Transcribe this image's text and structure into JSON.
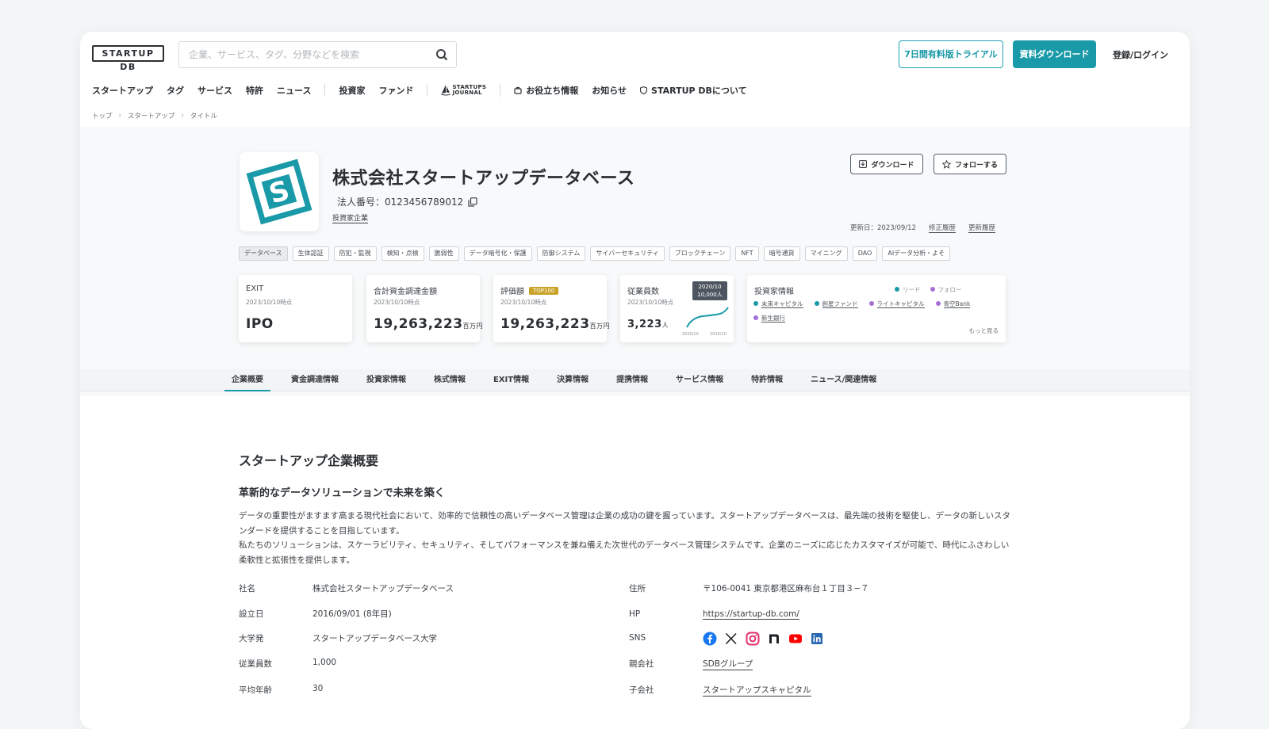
{
  "header": {
    "logo_text": "STARTUP DB",
    "search_placeholder": "企業、サービス、タグ、分野などを検索",
    "trial_button": "7日間有料版トライアル",
    "download_button": "資料ダウンロード",
    "login": "登録/ログイン"
  },
  "nav": {
    "items": [
      "スタートアップ",
      "タグ",
      "サービス",
      "特許",
      "ニュース"
    ],
    "investor_items": [
      "投資家",
      "ファンド"
    ],
    "journal": [
      "STARTUPS",
      "JOURNAL"
    ],
    "info": "お役立ち情報",
    "notice": "お知らせ",
    "about": "STARTUP DBについて"
  },
  "breadcrumb": [
    "トップ",
    "スタートアップ",
    "タイトル"
  ],
  "company": {
    "name": "株式会社スタートアップデータベース",
    "corp_number": "法人番号：0123456789012",
    "investor_tag": "投資家企業",
    "download": "ダウンロード",
    "follow": "フォローする",
    "updated": "更新日：2023/09/12",
    "edit_history": "修正履歴",
    "update_history": "更新履歴",
    "logo_letter": "S",
    "brand_color": "#1a9aa8"
  },
  "tags": [
    "データベース",
    "生体認証",
    "防犯・監視",
    "検知・点検",
    "脆弱性",
    "データ暗号化・保護",
    "防御システム",
    "サイバーセキュリティ",
    "ブロックチェーン",
    "NFT",
    "暗号通貨",
    "マイニング",
    "DAO",
    "AIデータ分析・よそ"
  ],
  "cards": {
    "exit": {
      "title": "EXIT",
      "date": "2023/10/10時点",
      "value": "IPO"
    },
    "funding": {
      "title": "合計資金調達金額",
      "date": "2023/10/10時点",
      "value": "19,263,223",
      "unit": "百万円"
    },
    "valuation": {
      "title": "評価額",
      "badge": "TOP100",
      "date": "2023/10/10時点",
      "value": "19,263,223",
      "unit": "百万円"
    },
    "employees": {
      "title": "従業員数",
      "date": "2023/10/10時点",
      "value": "3,223",
      "unit": "人",
      "tip_date": "2020/10",
      "tip_value": "10,000人",
      "axis_start": "2020/10",
      "axis_end": "2024/10"
    },
    "investors": {
      "title": "投資家情報",
      "legend_lead": "リード",
      "legend_follow": "フォロー",
      "lead_color": "#1a9aa8",
      "follow_color": "#a66fd8",
      "list": [
        {
          "name": "未来キャピタル",
          "type": "lead"
        },
        {
          "name": "創星ファンド",
          "type": "lead"
        },
        {
          "name": "ライトキャピタル",
          "type": "follow"
        },
        {
          "name": "青空Bank",
          "type": "follow"
        },
        {
          "name": "新生銀行",
          "type": "follow"
        }
      ],
      "more": "もっと見る"
    }
  },
  "tabs": [
    "企業概要",
    "資金調達情報",
    "投資家情報",
    "株式情報",
    "EXIT情報",
    "決算情報",
    "提携情報",
    "サービス情報",
    "特許情報",
    "ニュース/関連情報"
  ],
  "overview": {
    "title": "スタートアップ企業概要",
    "subtitle": "革新的なデータソリューションで未来を築く",
    "body1": "データの重要性がますます高まる現代社会において、効率的で信頼性の高いデータベース管理は企業の成功の鍵を握っています。スタートアップデータベースは、最先端の技術を駆使し、データの新しいスタンダードを提供することを目指しています。",
    "body2": "私たちのソリューションは、スケーラビリティ、セキュリティ、そしてパフォーマンスを兼ね備えた次世代のデータベース管理システムです。企業のニーズに応じたカスタマイズが可能で、時代にふさわしい柔軟性と拡張性を提供します。"
  },
  "details": {
    "left": [
      {
        "label": "社名",
        "value": "株式会社スタートアップデータベース"
      },
      {
        "label": "設立日",
        "value": "2016/09/01 (8年目)"
      },
      {
        "label": "大学発",
        "value": "スタートアップデータベース大学"
      },
      {
        "label": "従業員数",
        "value": "1,000"
      },
      {
        "label": "平均年齢",
        "value": "30"
      }
    ],
    "right": [
      {
        "label": "住所",
        "value": "〒106-0041 東京都港区麻布台１丁目３−７"
      },
      {
        "label": "HP",
        "value": "https://startup-db.com/"
      },
      {
        "label": "SNS",
        "value": ""
      },
      {
        "label": "親会社",
        "value": "SDBグループ"
      },
      {
        "label": "子会社",
        "value": "スタートアップスキャピタル"
      }
    ],
    "sns_icons": [
      "facebook-icon",
      "x-icon",
      "instagram-icon",
      "note-icon",
      "youtube-icon",
      "linkedin-icon"
    ]
  }
}
